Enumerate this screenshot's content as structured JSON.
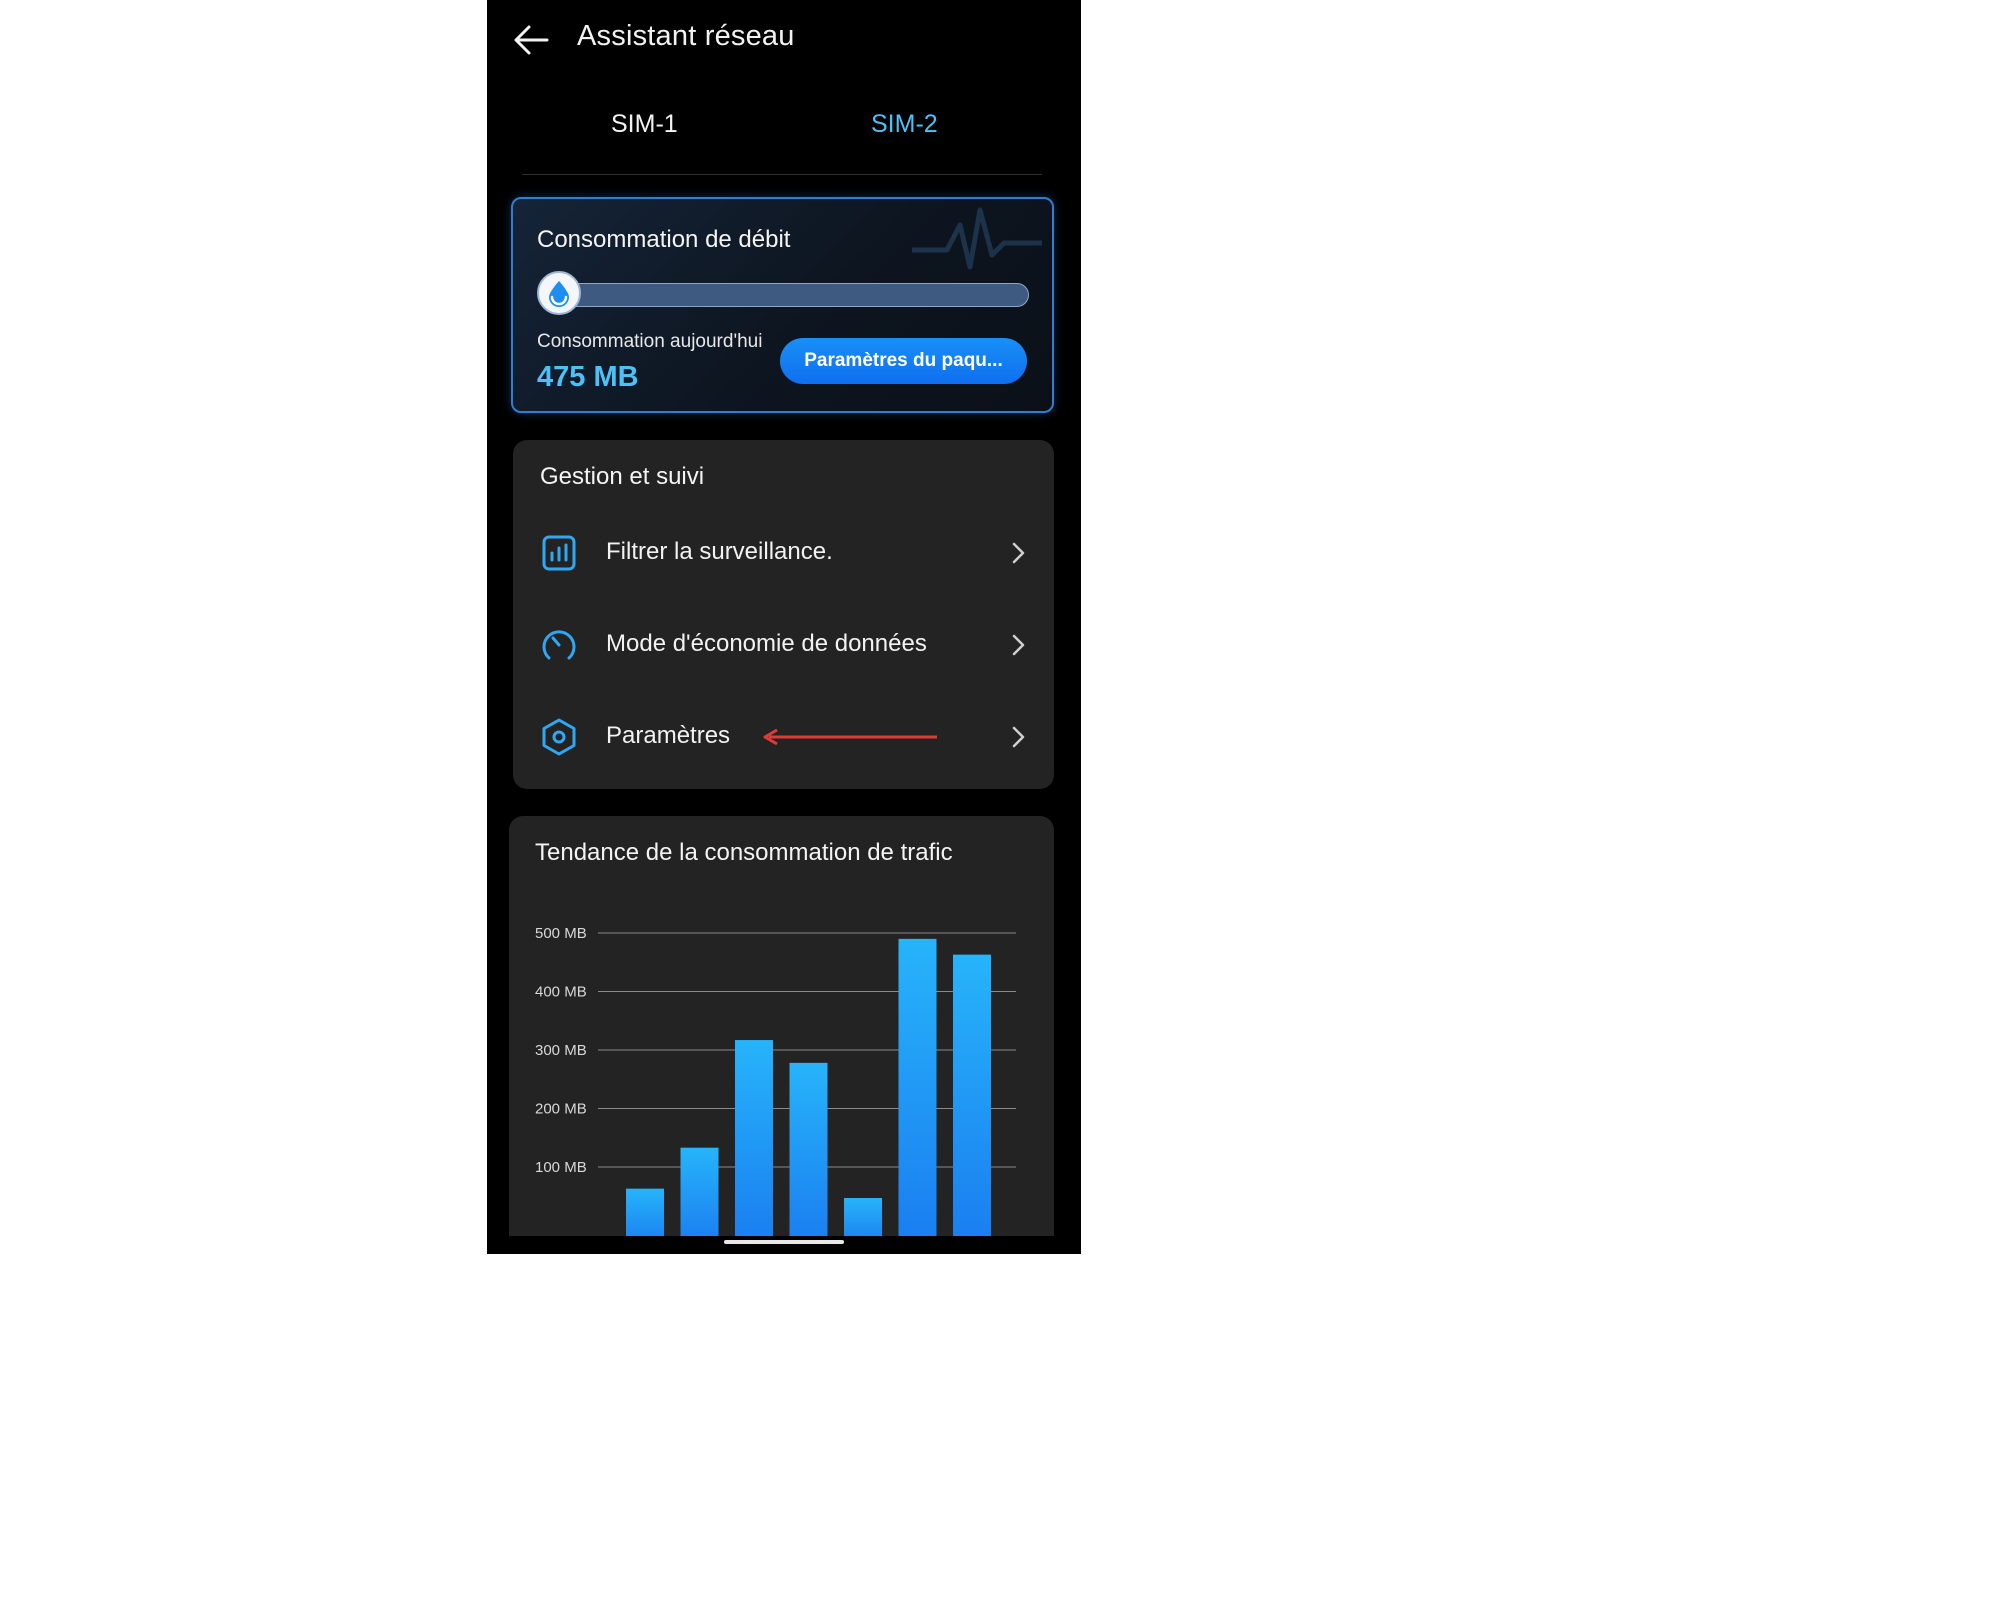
{
  "header": {
    "title": "Assistant réseau",
    "back_icon": "arrow-left-icon"
  },
  "tabs": [
    {
      "label": "SIM-1",
      "active": false
    },
    {
      "label": "SIM-2",
      "active": true
    }
  ],
  "usage_card": {
    "title": "Consommation de débit",
    "progress_fraction": 0.02,
    "knob_icon": "water-drop-icon",
    "today_label": "Consommation aujourd'hui",
    "today_value": "475 MB",
    "package_button": "Paramètres du paqu..."
  },
  "management": {
    "title": "Gestion et suivi",
    "items": [
      {
        "label": "Filtrer la surveillance.",
        "icon": "bar-chart-icon"
      },
      {
        "label": "Mode d'économie de données",
        "icon": "speedometer-icon"
      },
      {
        "label": "Paramètres",
        "icon": "hexagon-settings-icon"
      }
    ]
  },
  "trend": {
    "title": "Tendance de la consommation de trafic"
  },
  "colors": {
    "accent": "#4cc1f7",
    "button": "#1483f4",
    "annotation_arrow": "#e03a3a",
    "bar": "#1fa6f6"
  },
  "chart_data": {
    "type": "bar",
    "categories": [
      "",
      "",
      "",
      "",
      "",
      "",
      ""
    ],
    "values": [
      63,
      133,
      317,
      278,
      47,
      490,
      463
    ],
    "y_tick_labels": [
      "500 MB",
      "400 MB",
      "300 MB",
      "200 MB",
      "100 MB"
    ],
    "y_ticks": [
      500,
      400,
      300,
      200,
      100
    ],
    "ylim": [
      0,
      500
    ],
    "grid": true
  }
}
